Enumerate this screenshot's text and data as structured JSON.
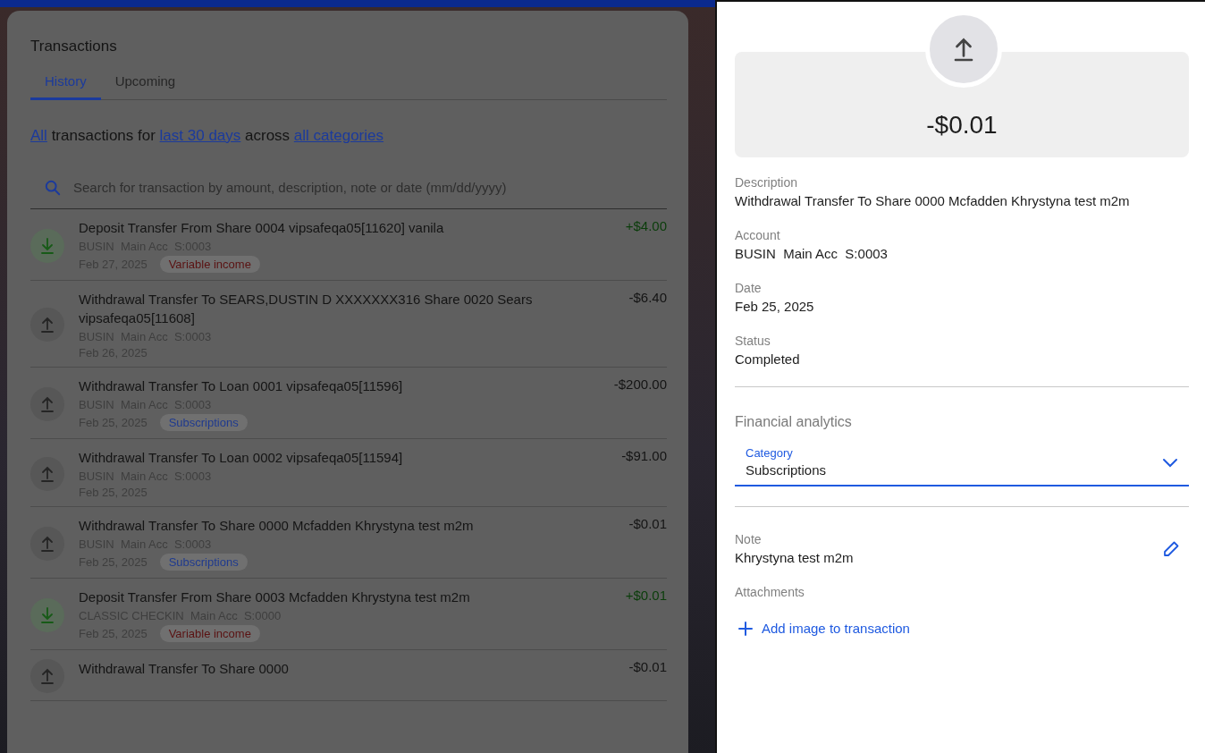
{
  "transactions_panel": {
    "title": "Transactions",
    "tabs": [
      {
        "label": "History",
        "selected": true
      },
      {
        "label": "Upcoming",
        "selected": false
      }
    ],
    "filter_sentence": [
      {
        "text": "All",
        "link": true
      },
      {
        "text": " transactions for ",
        "link": false
      },
      {
        "text": "last 30 days",
        "link": true
      },
      {
        "text": " across ",
        "link": false
      },
      {
        "text": "all categories",
        "link": true
      }
    ],
    "search": {
      "placeholder": "Search for transaction by amount, description, note or date (mm/dd/yyyy)"
    },
    "rows": [
      {
        "kind": "deposit",
        "description": "Deposit Transfer From Share 0004 vipsafeqa05[11620] vanila",
        "account": "BUSIN  Main Acc  S:0003",
        "date": "Feb 27, 2025",
        "tag": {
          "label": "Variable income",
          "color": "#5a1212"
        },
        "amount": "+$4.00"
      },
      {
        "kind": "withdrawal",
        "description": "Withdrawal Transfer To SEARS,DUSTIN D XXXXXXX316 Share 0020 Sears vipsafeqa05[11608]",
        "account": "BUSIN  Main Acc  S:0003",
        "date": "Feb 26, 2025",
        "amount": "-$6.40"
      },
      {
        "kind": "withdrawal",
        "description": "Withdrawal Transfer To Loan 0001 vipsafeqa05[11596]",
        "account": "BUSIN  Main Acc  S:0003",
        "date": "Feb 25, 2025",
        "tag": {
          "label": "Subscriptions",
          "color": "#1f3a8f"
        },
        "amount": "-$200.00"
      },
      {
        "kind": "withdrawal",
        "description": "Withdrawal Transfer To Loan 0002 vipsafeqa05[11594]",
        "account": "BUSIN  Main Acc  S:0003",
        "date": "Feb 25, 2025",
        "amount": "-$91.00"
      },
      {
        "kind": "withdrawal",
        "description": "Withdrawal Transfer To Share 0000 Mcfadden Khrystyna test m2m",
        "account": "BUSIN  Main Acc  S:0003",
        "date": "Feb 25, 2025",
        "tag": {
          "label": "Subscriptions",
          "color": "#1f3a8f"
        },
        "amount": "-$0.01"
      },
      {
        "kind": "deposit",
        "description": "Deposit Transfer From Share 0003 Mcfadden Khrystyna test m2m",
        "account": "CLASSIC CHECKIN  Main Acc  S:0000",
        "date": "Feb 25, 2025",
        "tag": {
          "label": "Variable income",
          "color": "#5a1212"
        },
        "amount": "+$0.01"
      },
      {
        "kind": "withdrawal",
        "description": "Withdrawal Transfer To Share 0000",
        "amount": "-$0.01"
      }
    ]
  },
  "detail_panel": {
    "kind": "withdrawal",
    "amount": "-$0.01",
    "fields": [
      {
        "label": "Description",
        "value": "Withdrawal Transfer To Share 0000 Mcfadden Khrystyna test m2m"
      },
      {
        "label": "Account",
        "value": "BUSIN  Main Acc  S:0003"
      },
      {
        "label": "Date",
        "value": "Feb 25, 2025"
      },
      {
        "label": "Status",
        "value": "Completed"
      }
    ],
    "analytics_title": "Financial analytics",
    "category": {
      "label": "Category",
      "value": "Subscriptions"
    },
    "note": {
      "label": "Note",
      "value": "Khrystyna test m2m"
    },
    "attachments_label": "Attachments",
    "add_image": "Add image to transaction"
  }
}
